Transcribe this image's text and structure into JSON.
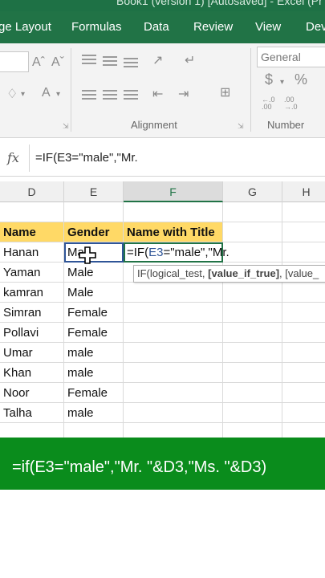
{
  "window": {
    "title": "Book1 (version 1) [Autosaved] - Excel (Pr"
  },
  "ribbon_tabs": [
    {
      "label": "ge Layout"
    },
    {
      "label": "Formulas"
    },
    {
      "label": "Data"
    },
    {
      "label": "Review"
    },
    {
      "label": "View"
    },
    {
      "label": "Dev"
    }
  ],
  "ribbon": {
    "alignment_label": "Alignment",
    "number_label": "Number",
    "number_format": "General",
    "currency_symbol": "$",
    "percent_symbol": "%"
  },
  "formula_bar": {
    "fx_label": "fx",
    "content": "=IF(E3=\"male\",\"Mr."
  },
  "columns": [
    {
      "label": "D"
    },
    {
      "label": "E"
    },
    {
      "label": "F"
    },
    {
      "label": "G"
    },
    {
      "label": "H"
    }
  ],
  "sheet": {
    "headers": {
      "name": "Name",
      "gender": "Gender",
      "title": "Name with Title"
    },
    "rows": [
      {
        "name": "Hanan",
        "gender": "Male"
      },
      {
        "name": "Yaman",
        "gender": "Male"
      },
      {
        "name": "kamran",
        "gender": "Male"
      },
      {
        "name": "Simran",
        "gender": "Female"
      },
      {
        "name": "Pollavi",
        "gender": "Female"
      },
      {
        "name": "Umar",
        "gender": "male"
      },
      {
        "name": "Khan",
        "gender": "male"
      },
      {
        "name": "Noor",
        "gender": "Female"
      },
      {
        "name": "Talha",
        "gender": "male"
      }
    ],
    "edit_cell": {
      "prefix": "=IF(",
      "ref": "E3",
      "suffix": "=\"male\",\"Mr."
    },
    "partial_gender": "Ma"
  },
  "tooltip": {
    "prefix": "IF(logical_test, ",
    "bold": "[value_if_true]",
    "suffix": ", [value_"
  },
  "banner": {
    "text": "=if(E3=\"male\",\"Mr. \"&D3,\"Ms. \"&D3)"
  },
  "colors": {
    "excel_green": "#217346",
    "banner_green": "#0a8c1c",
    "header_yellow": "#ffd966",
    "selection_blue": "#2f5597"
  }
}
